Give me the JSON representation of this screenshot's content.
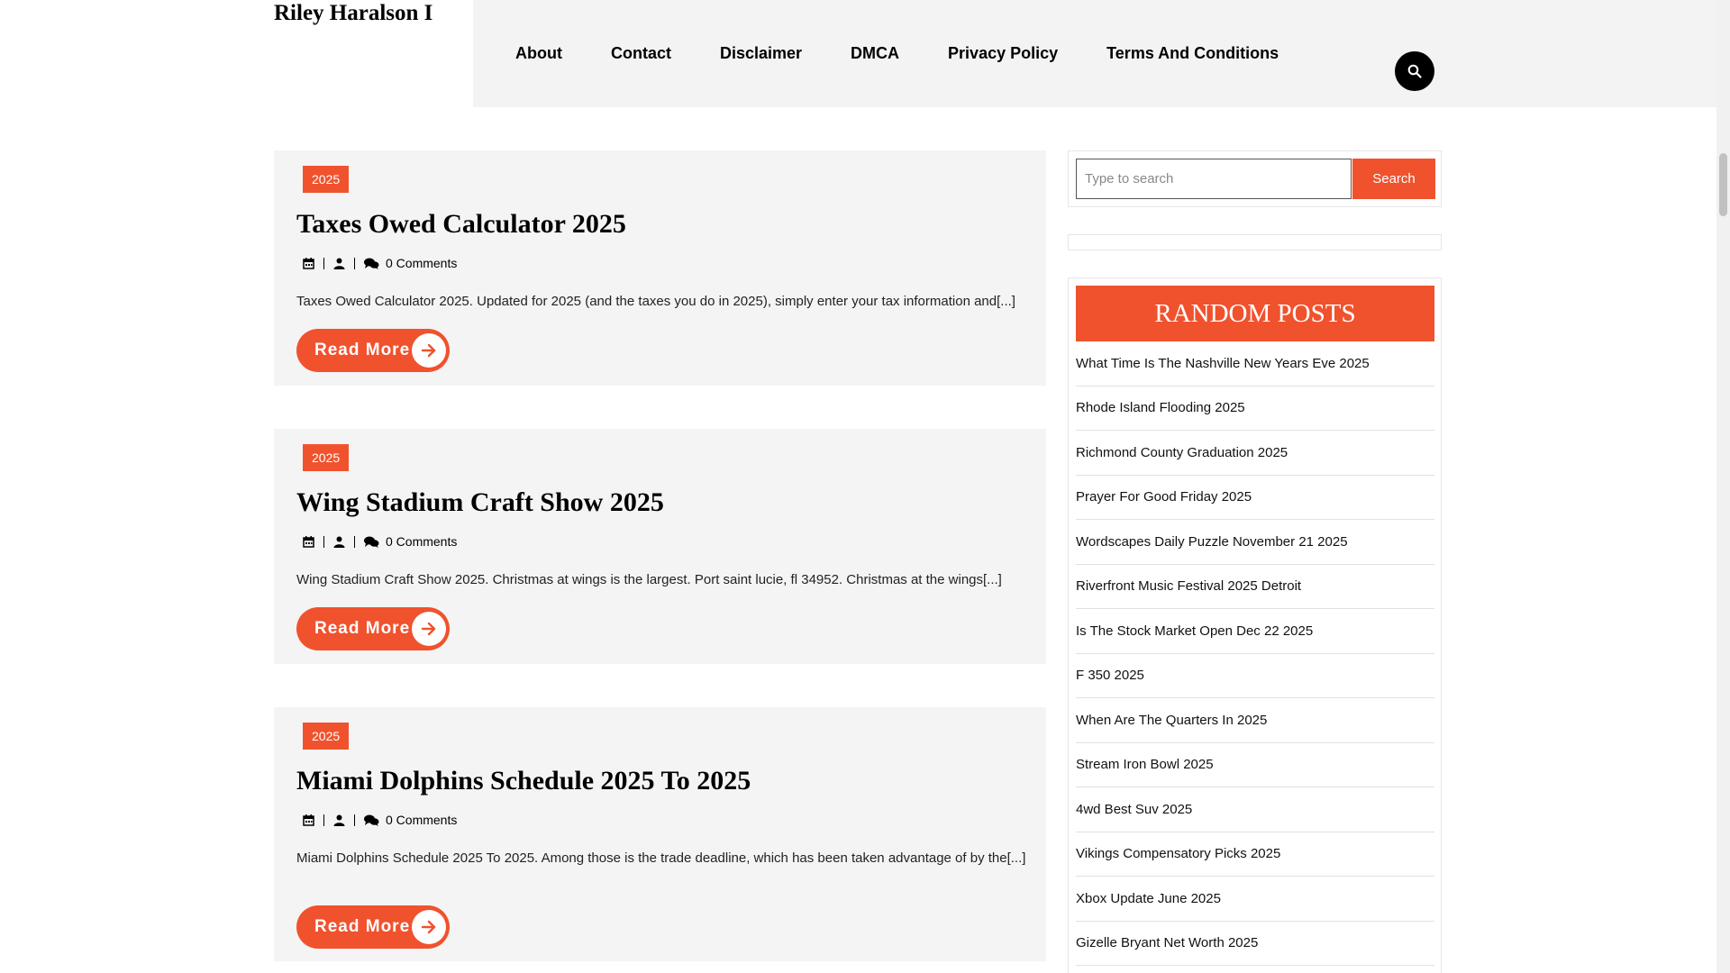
{
  "site": {
    "title": "Riley Haralson I"
  },
  "nav": {
    "items": [
      {
        "label": "About"
      },
      {
        "label": "Contact"
      },
      {
        "label": "Disclaimer"
      },
      {
        "label": "DMCA"
      },
      {
        "label": "Privacy Policy"
      },
      {
        "label": "Terms And Conditions"
      }
    ],
    "search_icon": "search-icon"
  },
  "posts": [
    {
      "category": "2025",
      "title": "Taxes Owed Calculator 2025",
      "comments": "0 Comments",
      "excerpt": "Taxes Owed Calculator 2025. Updated for 2025 (and the taxes you do in 2025), simply enter your tax information and[...]",
      "read_more": "Read More"
    },
    {
      "category": "2025",
      "title": "Wing Stadium Craft Show 2025",
      "comments": "0 Comments",
      "excerpt": "Wing Stadium Craft Show 2025. Christmas at wings is the largest. Port saint lucie, fl 34952. Christmas at the wings[...]",
      "read_more": "Read More"
    },
    {
      "category": "2025",
      "title": "Miami Dolphins Schedule 2025 To 2025",
      "comments": "0 Comments",
      "excerpt": "Miami Dolphins Schedule 2025 To 2025. Among those is the trade deadline, which has been taken advantage of by the[...]",
      "read_more": "Read More"
    }
  ],
  "sidebar": {
    "search": {
      "placeholder": "Type to search",
      "button": "Search"
    },
    "random_posts": {
      "title": "RANDOM POSTS",
      "items": [
        "What Time Is The Nashville New Years Eve 2025",
        "Rhode Island Flooding 2025",
        "Richmond County Graduation 2025",
        "Prayer For Good Friday 2025",
        "Wordscapes Daily Puzzle November 21 2025",
        "Riverfront Music Festival 2025 Detroit",
        "Is The Stock Market Open Dec 22 2025",
        "F 350 2025",
        "When Are The Quarters In 2025",
        "Stream Iron Bowl 2025",
        "4wd Best Suv 2025",
        "Vikings Compensatory Picks 2025",
        "Xbox Update June 2025",
        "Gizelle Bryant Net Worth 2025"
      ]
    }
  },
  "colors": {
    "accent": "#f0522e",
    "header_bg": "#f3f3f3",
    "post_bg": "#f4f4f4"
  }
}
